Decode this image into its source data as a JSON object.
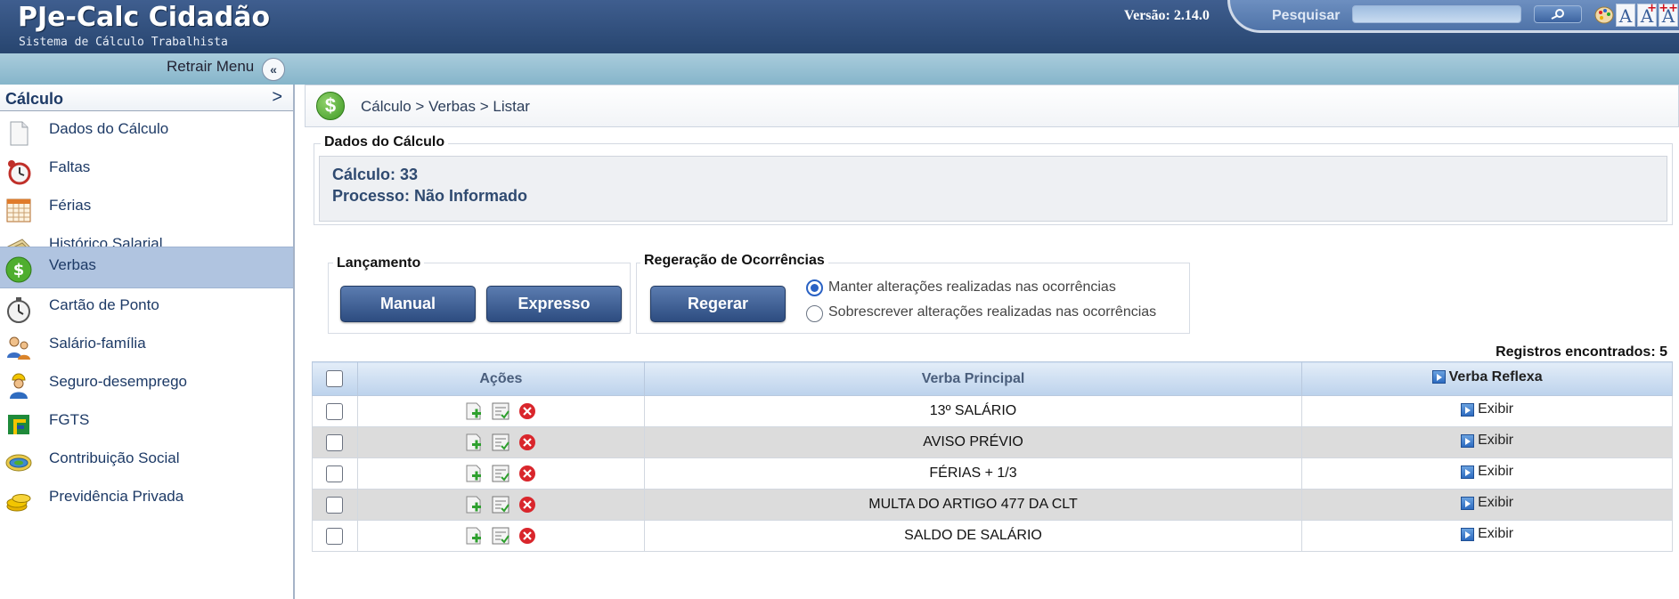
{
  "header": {
    "title": "PJe-Calc Cidadão",
    "subtitle": "Sistema de Cálculo Trabalhista",
    "version": "Versão: 2.14.0",
    "search_label": "Pesquisar",
    "search_value": "",
    "font_buttons": [
      "A",
      "A",
      "A"
    ]
  },
  "subbar": {
    "retrair_label": "Retrair Menu"
  },
  "sidebar": {
    "title": "Cálculo",
    "items": [
      {
        "label": "Dados do Cálculo",
        "icon": "document-icon"
      },
      {
        "label": "Faltas",
        "icon": "alarm-clock-icon"
      },
      {
        "label": "Férias",
        "icon": "calendar-icon"
      },
      {
        "label": "Histórico Salarial",
        "icon": "paper-stack-icon"
      },
      {
        "label": "Verbas",
        "icon": "dollar-icon",
        "active": true
      },
      {
        "label": "Cartão de Ponto",
        "icon": "stopwatch-icon"
      },
      {
        "label": "Salário-família",
        "icon": "family-icon"
      },
      {
        "label": "Seguro-desemprego",
        "icon": "worker-icon"
      },
      {
        "label": "FGTS",
        "icon": "fgts-flag-icon"
      },
      {
        "label": "Contribuição Social",
        "icon": "contribution-icon"
      },
      {
        "label": "Previdência Privada",
        "icon": "coins-icon"
      }
    ]
  },
  "breadcrumb": "Cálculo > Verbas > Listar",
  "dados": {
    "legend": "Dados do Cálculo",
    "calculo": "Cálculo: 33",
    "processo": "Processo: Não Informado"
  },
  "lancamento": {
    "legend": "Lançamento",
    "manual_label": "Manual",
    "expresso_label": "Expresso"
  },
  "regeracao": {
    "legend": "Regeração de Ocorrências",
    "button_label": "Regerar",
    "options": [
      {
        "label": "Manter alterações realizadas nas ocorrências",
        "selected": true
      },
      {
        "label": "Sobrescrever alterações realizadas nas ocorrências",
        "selected": false
      }
    ]
  },
  "registros": "Registros encontrados: 5",
  "table": {
    "headers": {
      "acoes": "Ações",
      "verba_principal": "Verba Principal",
      "verba_reflexa": "Verba Reflexa"
    },
    "rows": [
      {
        "verba": "13º SALÁRIO",
        "reflexa": "Exibir"
      },
      {
        "verba": "AVISO PRÉVIO",
        "reflexa": "Exibir"
      },
      {
        "verba": "FÉRIAS + 1/3",
        "reflexa": "Exibir"
      },
      {
        "verba": "MULTA DO ARTIGO 477 DA CLT",
        "reflexa": "Exibir"
      },
      {
        "verba": "SALDO DE SALÁRIO",
        "reflexa": "Exibir"
      }
    ]
  },
  "colors": {
    "header_blue": "#27456f",
    "active_item": "#b0c4e0",
    "button_blue": "#2d4c80",
    "delete_red": "#d9262c",
    "dollar_green": "#3f9a25"
  }
}
